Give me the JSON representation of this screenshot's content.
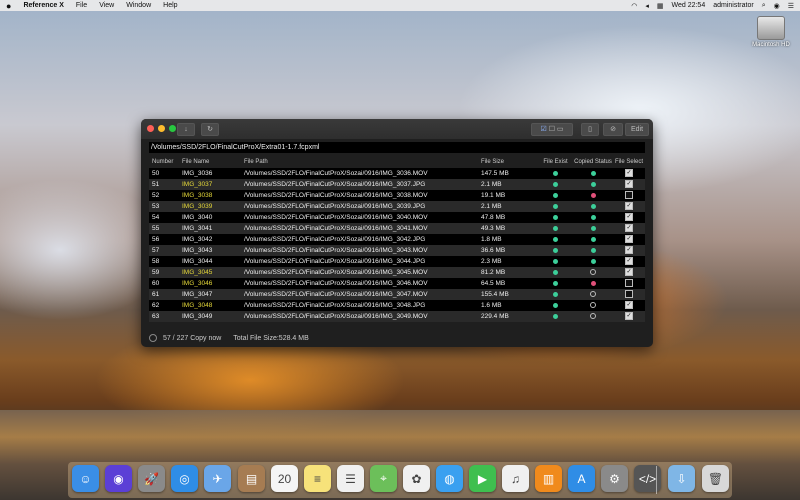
{
  "menubar": {
    "apple": "",
    "app_name": "Reference X",
    "items": [
      "File",
      "View",
      "Window",
      "Help"
    ],
    "clock": "Wed 22:54",
    "user": "administrator"
  },
  "desktop": {
    "hd_label": "Macintosh HD"
  },
  "window": {
    "file_path": "/Volumes/SSD/2FLO/FinalCutProX/Extra01-1.7.fcpxml",
    "toolbar": {
      "edit_label": "Edit"
    },
    "columns": [
      "Number",
      "File Name",
      "File Path",
      "File Size",
      "File Exist",
      "Copied Status",
      "File Select"
    ],
    "rows": [
      {
        "num": "50",
        "name": "IMG_3036",
        "path": "/Volumes/SSD/2FLO/FinalCutProX/Sozai/0916/IMG_3036.MOV",
        "size": "147.5 MB",
        "exist": "ok",
        "copied": "ok",
        "select": true,
        "highlight": false
      },
      {
        "num": "51",
        "name": "IMG_3037",
        "path": "/Volumes/SSD/2FLO/FinalCutProX/Sozai/0916/IMG_3037.JPG",
        "size": "2.1 MB",
        "exist": "ok",
        "copied": "ok",
        "select": true,
        "highlight": true
      },
      {
        "num": "52",
        "name": "IMG_3038",
        "path": "/Volumes/SSD/2FLO/FinalCutProX/Sozai/0916/IMG_3038.MOV",
        "size": "19.1 MB",
        "exist": "ok",
        "copied": "bad",
        "select": false,
        "highlight": true
      },
      {
        "num": "53",
        "name": "IMG_3039",
        "path": "/Volumes/SSD/2FLO/FinalCutProX/Sozai/0916/IMG_3039.JPG",
        "size": "2.1 MB",
        "exist": "ok",
        "copied": "ok",
        "select": true,
        "highlight": true
      },
      {
        "num": "54",
        "name": "IMG_3040",
        "path": "/Volumes/SSD/2FLO/FinalCutProX/Sozai/0916/IMG_3040.MOV",
        "size": "47.8 MB",
        "exist": "ok",
        "copied": "ok",
        "select": true,
        "highlight": false
      },
      {
        "num": "55",
        "name": "IMG_3041",
        "path": "/Volumes/SSD/2FLO/FinalCutProX/Sozai/0916/IMG_3041.MOV",
        "size": "49.3 MB",
        "exist": "ok",
        "copied": "ok",
        "select": true,
        "highlight": false
      },
      {
        "num": "56",
        "name": "IMG_3042",
        "path": "/Volumes/SSD/2FLO/FinalCutProX/Sozai/0916/IMG_3042.JPG",
        "size": "1.8 MB",
        "exist": "ok",
        "copied": "ok",
        "select": true,
        "highlight": false
      },
      {
        "num": "57",
        "name": "IMG_3043",
        "path": "/Volumes/SSD/2FLO/FinalCutProX/Sozai/0916/IMG_3043.MOV",
        "size": "36.6 MB",
        "exist": "ok",
        "copied": "ok",
        "select": true,
        "highlight": false
      },
      {
        "num": "58",
        "name": "IMG_3044",
        "path": "/Volumes/SSD/2FLO/FinalCutProX/Sozai/0916/IMG_3044.JPG",
        "size": "2.3 MB",
        "exist": "ok",
        "copied": "ok",
        "select": true,
        "highlight": false
      },
      {
        "num": "59",
        "name": "IMG_3045",
        "path": "/Volumes/SSD/2FLO/FinalCutProX/Sozai/0916/IMG_3045.MOV",
        "size": "81.2 MB",
        "exist": "ok",
        "copied": "empty",
        "select": true,
        "highlight": true
      },
      {
        "num": "60",
        "name": "IMG_3046",
        "path": "/Volumes/SSD/2FLO/FinalCutProX/Sozai/0916/IMG_3046.MOV",
        "size": "64.5 MB",
        "exist": "ok",
        "copied": "bad",
        "select": false,
        "highlight": true
      },
      {
        "num": "61",
        "name": "IMG_3047",
        "path": "/Volumes/SSD/2FLO/FinalCutProX/Sozai/0916/IMG_3047.MOV",
        "size": "155.4 MB",
        "exist": "ok",
        "copied": "empty",
        "select": false,
        "highlight": false
      },
      {
        "num": "62",
        "name": "IMG_3048",
        "path": "/Volumes/SSD/2FLO/FinalCutProX/Sozai/0916/IMG_3048.JPG",
        "size": "1.6 MB",
        "exist": "ok",
        "copied": "empty",
        "select": true,
        "highlight": true
      },
      {
        "num": "63",
        "name": "IMG_3049",
        "path": "/Volumes/SSD/2FLO/FinalCutProX/Sozai/0916/IMG_3049.MOV",
        "size": "229.4 MB",
        "exist": "ok",
        "copied": "empty",
        "select": true,
        "highlight": false
      }
    ],
    "status": {
      "progress": "57 / 227 Copy now",
      "total_size": "Total File Size:528.4 MB"
    }
  },
  "dock": {
    "icons": [
      {
        "name": "finder-icon",
        "glyph": "☺",
        "color": "#3a8ee6"
      },
      {
        "name": "siri-icon",
        "glyph": "◉",
        "color": "#5b3fd6"
      },
      {
        "name": "launchpad-icon",
        "glyph": "🚀",
        "color": "#8a8a8a"
      },
      {
        "name": "safari-icon",
        "glyph": "◎",
        "color": "#2f8de6"
      },
      {
        "name": "mail-icon",
        "glyph": "✈",
        "color": "#6aa6e8"
      },
      {
        "name": "notes-book-icon",
        "glyph": "▤",
        "color": "#a67c52"
      },
      {
        "name": "calendar-icon",
        "glyph": "20",
        "color": "#f5f5f5"
      },
      {
        "name": "notes-icon",
        "glyph": "≡",
        "color": "#f7e27a"
      },
      {
        "name": "reminders-icon",
        "glyph": "☰",
        "color": "#f0f0f0"
      },
      {
        "name": "maps-icon",
        "glyph": "⌖",
        "color": "#6cbf5a"
      },
      {
        "name": "photos-icon",
        "glyph": "✿",
        "color": "#f0f0f0"
      },
      {
        "name": "messages-icon",
        "glyph": "◍",
        "color": "#3aa0f0"
      },
      {
        "name": "facetime-icon",
        "glyph": "▶",
        "color": "#3fbf4f"
      },
      {
        "name": "music-icon",
        "glyph": "♫",
        "color": "#f0f0f0"
      },
      {
        "name": "books-icon",
        "glyph": "▥",
        "color": "#f08a1c"
      },
      {
        "name": "app-store-icon",
        "glyph": "A",
        "color": "#2f8de6"
      },
      {
        "name": "system-preferences-icon",
        "glyph": "⚙",
        "color": "#8a8a8a"
      },
      {
        "name": "script-editor-icon",
        "glyph": "</>",
        "color": "#555555"
      },
      {
        "name": "downloads-folder-icon",
        "glyph": "⇩",
        "color": "#7fb6e6"
      },
      {
        "name": "trash-icon",
        "glyph": "🗑",
        "color": "#d8d8d8"
      }
    ]
  }
}
